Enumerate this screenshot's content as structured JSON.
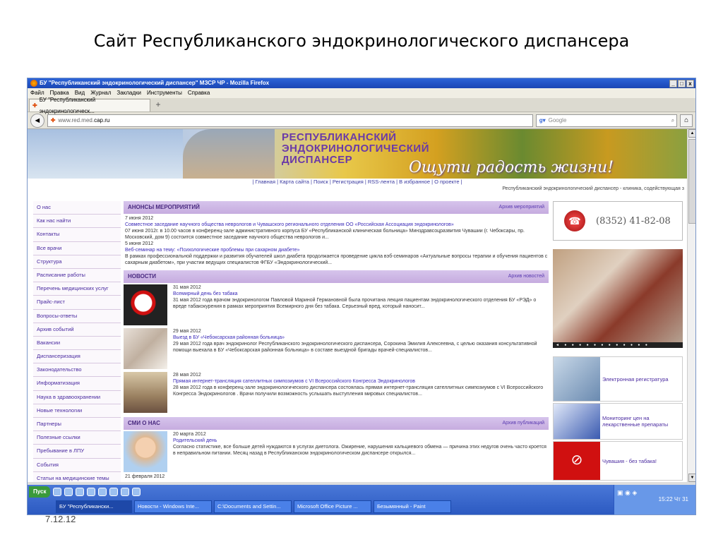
{
  "slide": {
    "title": "Сайт Республиканского эндокринологического диспансера",
    "date": "7.12.12"
  },
  "window": {
    "title": "БУ \"Республиканский эндокринологический диспансер\" МЗСР ЧР - Mozilla Firefox",
    "btn_min": "_",
    "btn_max": "□",
    "btn_close": "x"
  },
  "menu": [
    "Файл",
    "Правка",
    "Вид",
    "Журнал",
    "Закладки",
    "Инструменты",
    "Справка"
  ],
  "tab": {
    "label": "БУ \"Республиканский эндокринологическ...",
    "new_tab": "+"
  },
  "nav": {
    "url_prefix": "www.red.med.",
    "url_domain": "cap.ru",
    "search_placeholder": "Google",
    "back": "◄",
    "home": "⌂"
  },
  "banner": {
    "line1": "РЕСПУБЛИКАНСКИЙ",
    "line2": "ЭНДОКРИНОЛОГИЧЕСКИЙ",
    "line3": "ДИСПАНСЕР",
    "slogan": "Ощути радость жизни!"
  },
  "toplinks": "| Главная | Карта сайта | Поиск | Регистрация | RSS-лента | В избранное | О проекте |",
  "tagline": "Республиканский эндокринологический диспансер - клиника, содействующая з",
  "leftnav": [
    "О нас",
    "Как нас найти",
    "Контакты",
    "Все врачи",
    "Структура",
    "Расписание работы",
    "Перечень медицинских услуг",
    "Прайс-лист",
    "Вопросы-ответы",
    "Архив событий",
    "Вакансии",
    "Диспансеризация",
    "Законодательство",
    "Информатизация",
    "Наука в здравоохранении",
    "Новые технологии",
    "Партнеры",
    "Полезные ссылки",
    "Пребывание в ЛПУ",
    "События",
    "Статьи на медицинские темы"
  ],
  "announce": {
    "head": "АНОНСЫ МЕРОПРИЯТИЙ",
    "archive": "Архив мероприятий",
    "items": [
      {
        "date": "7 июня 2012",
        "title": "Совместное заседание научного общества неврологов и Чувашского регионального отделения ОО «Российская Ассоциация эндокринологов»",
        "text": "07 июня 2012г. в 10.00 часов в конференц-зале административного корпуса БУ «Республиканской клиническая больница» Минздравсоцразвития Чувашии (г. Чебоксары, пр. Московский, дом 9) состоится совместное заседание научного общества неврологов и..."
      },
      {
        "date": "5 июня 2012",
        "title": "Веб-семинар на тему: «Психологические проблемы при сахарном диабете»",
        "text": "В рамках профессиональной поддержки и развития обучателей школ диабета продолжается проведение цикла вэб-семинаров «Актуальные вопросы терапии и обучения пациентов с сахарным диабетом», при участии ведущих специалистов ФГБУ «Эндокринологический..."
      }
    ]
  },
  "news": {
    "head": "НОВОСТИ",
    "archive": "Архив новостей",
    "items": [
      {
        "date": "31 мая 2012",
        "title": "Всемирный день без табака",
        "text": "31 мая 2012 года врачом эндокринологом Павловой Мариной Германовной была прочитана лекция пациентам эндокринологического отделения БУ «РЭД» о вреде табакокурения в рамках мероприятия Всемирного дня без табака. Серьезный вред, который наносит..."
      },
      {
        "date": "29 мая 2012",
        "title": "Выезд в БУ «Чебоксарская районная больница»",
        "text": "29 мая 2012 года врач эндокринолог Республиканского эндокринологического диспансера, Сорокина Эмилия Алексеевна, с целью оказания консультативной помощи выехала в БУ «Чебоксарская районная больница» в составе выездной бригады врачей-специалистов..."
      },
      {
        "date": "28 мая 2012",
        "title": "Прямая интернет-трансляция сателлитных симпозиумов с VI Всероссийского Конгресса Эндокринологов",
        "text": "28 мая 2012 года в конференц-зале эндокринологического диспансера состоялась прямая интернет-трансляция сателлитных симпозиумов с VI Всероссийского Конгресса Эндокринологов . Врачи получили возможность услышать выступления мировых специалистов..."
      }
    ]
  },
  "smi": {
    "head": "СМИ О НАС",
    "archive": "Архив публикаций",
    "items": [
      {
        "date": "20 марта 2012",
        "title": "Родительский день",
        "text": "Согласно статистике, все больше детей нуждаются в услугах диетолога. Ожирение, нарушения кальциевого обмена — причина этих недугов очень часто кроется в неправильном питании. Месяц назад в Республиканском эндокринологическом диспансере открылся..."
      }
    ],
    "cut_date": "21 февраля 2012"
  },
  "right": {
    "phone": "(8352) 41-82-08",
    "blocks": [
      "Электронная регистратура",
      "Мониторинг цен на лекарственные препараты",
      "Чувашия - без табака!"
    ]
  },
  "taskbar": {
    "start": "Пуск",
    "buttons": [
      "БУ \"Республикански...",
      "Новости - Windows Inte...",
      "C:\\Documents and Settin...",
      "Microsoft Office Picture ...",
      "Безымянный - Paint"
    ],
    "clock": "15:22 Чт 31"
  }
}
